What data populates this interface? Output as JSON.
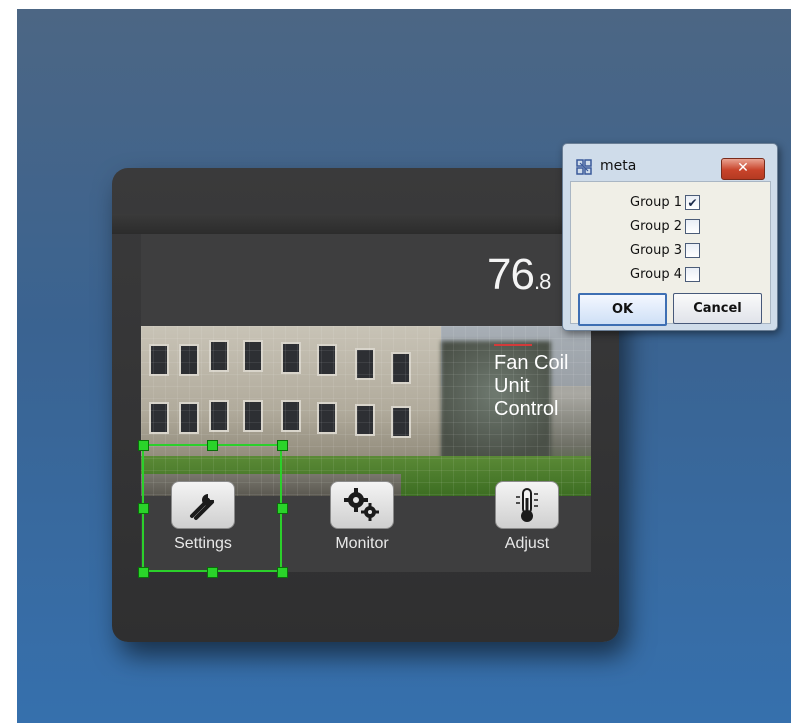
{
  "display": {
    "temperature_int": "76",
    "temperature_frac": ".8",
    "title_line1": "Fan Coil",
    "title_line2": "Unit",
    "title_line3": "Control",
    "accent_color": "#d23a3a"
  },
  "nav": {
    "items": [
      {
        "label": "Settings",
        "icon": "wrench-screwdriver-icon"
      },
      {
        "label": "Monitor",
        "icon": "gears-icon"
      },
      {
        "label": "Adjust",
        "icon": "thermometer-icon"
      }
    ]
  },
  "selection": {
    "color": "#2ad42a"
  },
  "dialog": {
    "title": "meta",
    "close_label": "✕",
    "groups": [
      {
        "label": "Group 1",
        "checked": true
      },
      {
        "label": "Group 2",
        "checked": false
      },
      {
        "label": "Group 3",
        "checked": false
      },
      {
        "label": "Group 4",
        "checked": false
      }
    ],
    "ok_label": "OK",
    "cancel_label": "Cancel"
  }
}
